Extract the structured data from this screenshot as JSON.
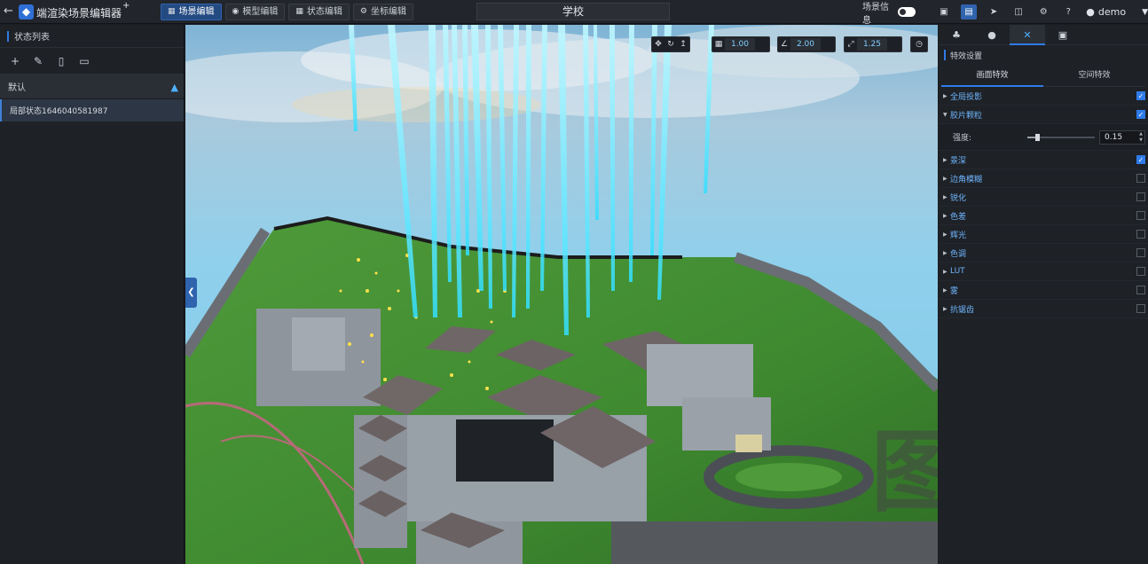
{
  "topbar": {
    "app_title": "端渲染场景编辑器",
    "app_title_mark": "+",
    "scene_title": "学校",
    "mode_tabs": [
      {
        "label": "场景编辑",
        "icon": "scene-icon",
        "active": true
      },
      {
        "label": "模型编辑",
        "icon": "model-icon",
        "active": false
      },
      {
        "label": "状态编辑",
        "icon": "state-icon",
        "active": false
      },
      {
        "label": "坐标编辑",
        "icon": "coordinate-icon",
        "active": false
      }
    ],
    "scene_info_label": "场景信息",
    "scene_info_enabled": false,
    "user_name": "demo"
  },
  "left_panel": {
    "title": "状态列表",
    "tools": [
      "add-icon",
      "edit-icon",
      "copy-icon",
      "delete-icon"
    ],
    "group_label": "默认",
    "state_item": "局部状态1646040581987"
  },
  "viewport": {
    "move_speed": "1.00",
    "angle": "2.00",
    "scale": "1.25",
    "watermark_text": "图观",
    "watermark_mark": "TM"
  },
  "right_panel": {
    "tabs": [
      "environment-icon",
      "light-icon",
      "effects-icon",
      "image-icon"
    ],
    "active_tab": 2,
    "section_title": "特效设置",
    "sub_tabs": [
      "画面特效",
      "空间特效"
    ],
    "active_sub_tab": 0,
    "effects": [
      {
        "name": "全局投影",
        "checked": true,
        "expanded": false
      },
      {
        "name": "胶片颗粒",
        "checked": true,
        "expanded": true
      },
      {
        "name": "景深",
        "checked": true,
        "expanded": false
      },
      {
        "name": "边角模糊",
        "checked": false,
        "expanded": false
      },
      {
        "name": "锐化",
        "checked": false,
        "expanded": false
      },
      {
        "name": "色差",
        "checked": false,
        "expanded": false
      },
      {
        "name": "辉光",
        "checked": false,
        "expanded": false
      },
      {
        "name": "色调",
        "checked": false,
        "expanded": false
      },
      {
        "name": "LUT",
        "checked": false,
        "expanded": false
      },
      {
        "name": "雾",
        "checked": false,
        "expanded": false
      },
      {
        "name": "抗锯齿",
        "checked": false,
        "expanded": false
      }
    ],
    "grain_intensity_label": "强度:",
    "grain_intensity_value": "0.15",
    "grain_intensity_fraction": 0.15
  },
  "colors": {
    "accent": "#2f7be8",
    "active_tab_bg": "#244a82",
    "beam": "#5fe8ff",
    "grass": "#4f9a3a"
  }
}
